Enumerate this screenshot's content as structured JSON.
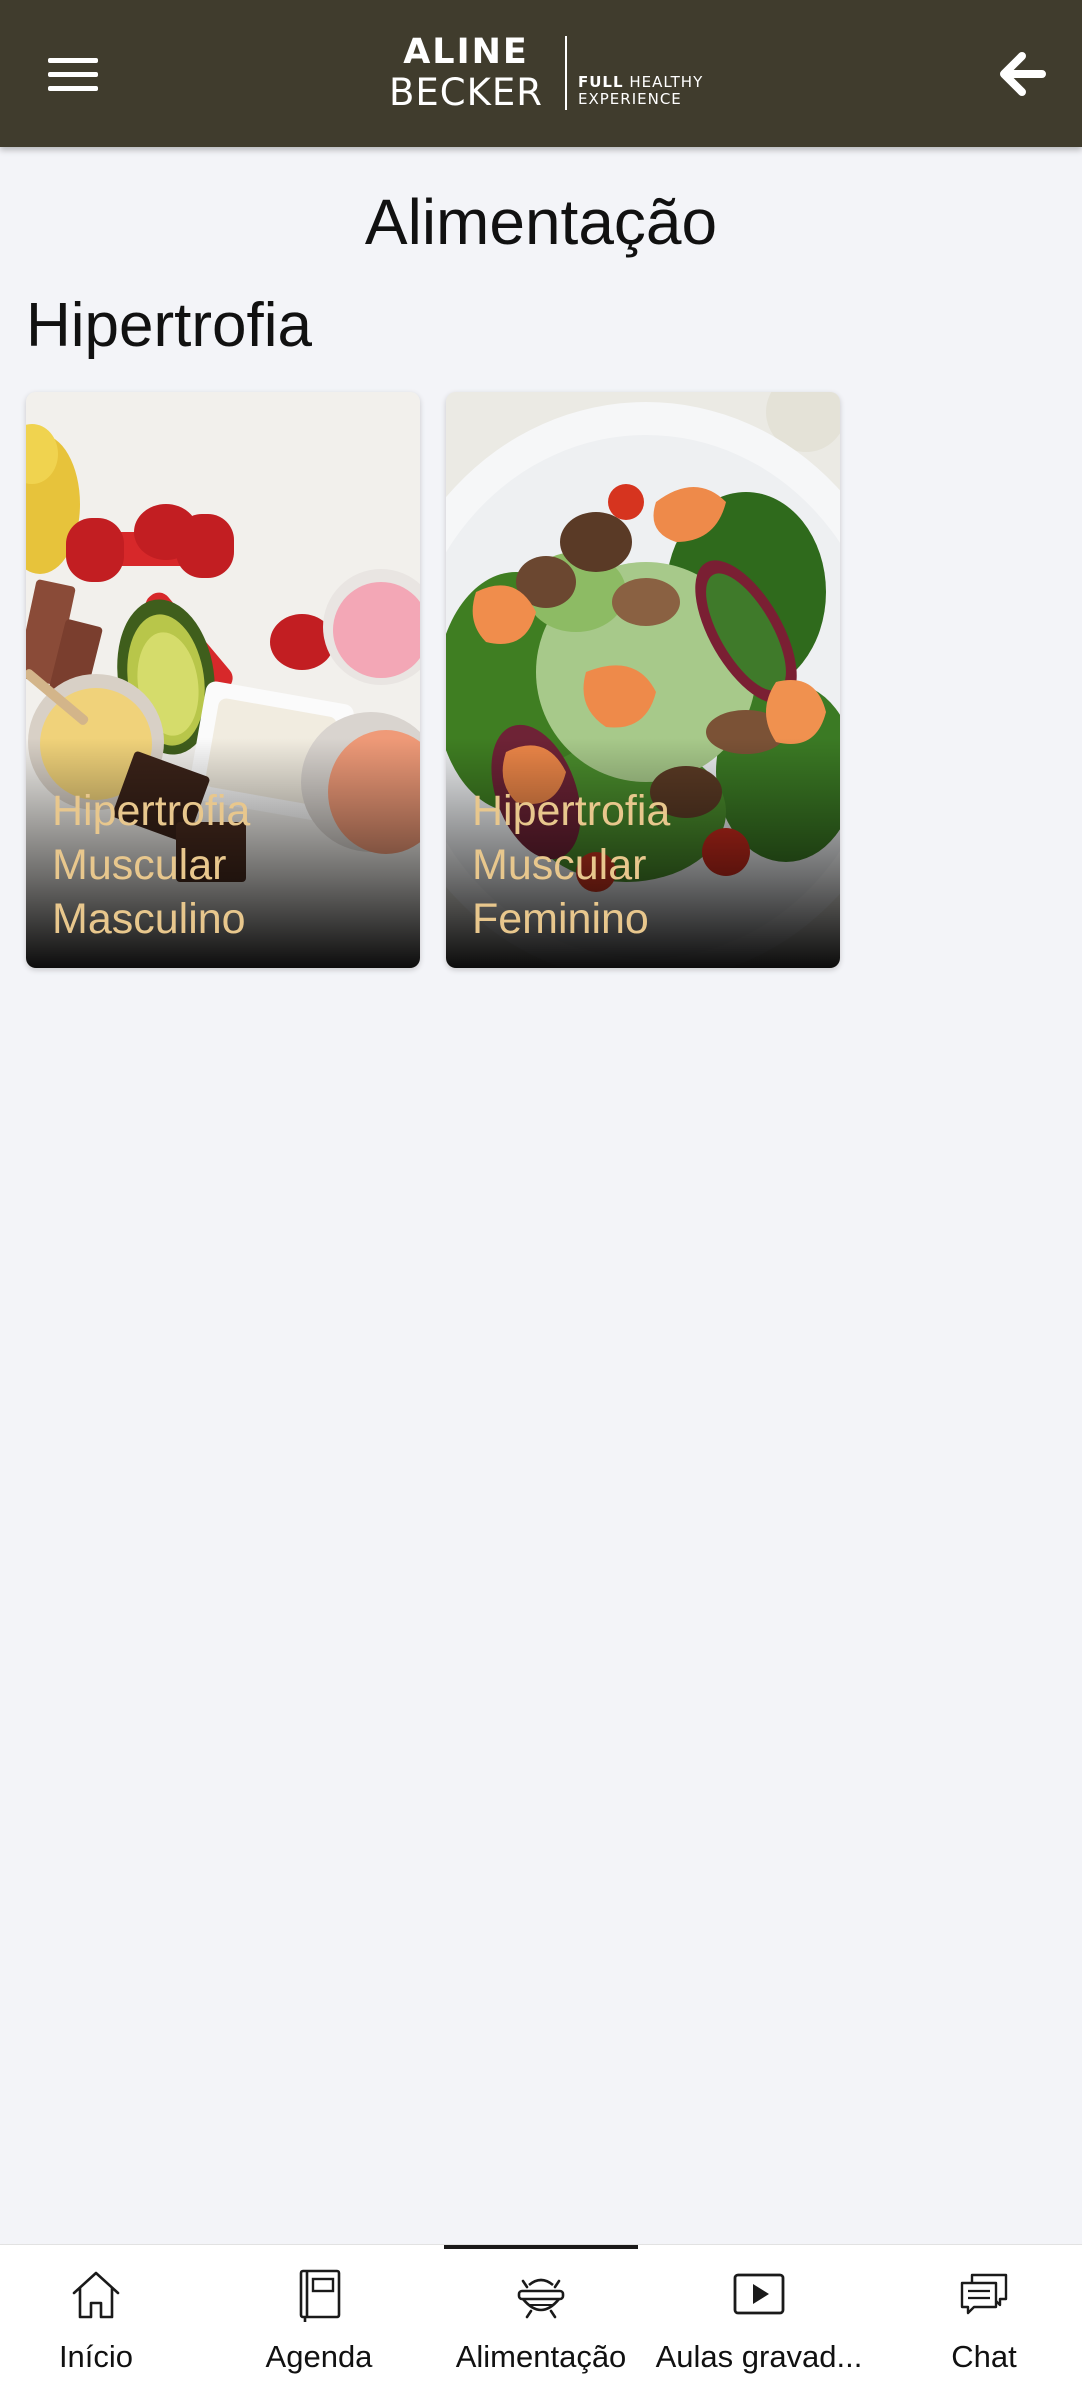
{
  "header": {
    "logo_line1": "ALINE",
    "logo_line2": "BECKER",
    "logo_tag1_bold": "FULL",
    "logo_tag1_rest": " HEALTHY",
    "logo_tag2": "EXPERIENCE",
    "menu_icon": "hamburger-menu-icon",
    "back_icon": "arrow-left-icon",
    "background_color": "#403c2d"
  },
  "page": {
    "title": "Alimentação"
  },
  "section": {
    "title": "Hipertrofia",
    "cards": [
      {
        "label": "Hipertrofia Muscular Masculino",
        "image": "dumbbells-avocado-food-photo"
      },
      {
        "label": "Hipertrofia Muscular Feminino",
        "image": "shrimp-salad-photo"
      }
    ],
    "label_color": "#e8c78d"
  },
  "bottom_nav": {
    "active_index": 2,
    "items": [
      {
        "label": "Início",
        "icon": "home-icon"
      },
      {
        "label": "Agenda",
        "icon": "notebook-icon"
      },
      {
        "label": "Alimentação",
        "icon": "food-bowl-icon"
      },
      {
        "label": "Aulas gravad...",
        "icon": "play-video-icon"
      },
      {
        "label": "Chat",
        "icon": "chat-bubbles-icon"
      }
    ]
  }
}
